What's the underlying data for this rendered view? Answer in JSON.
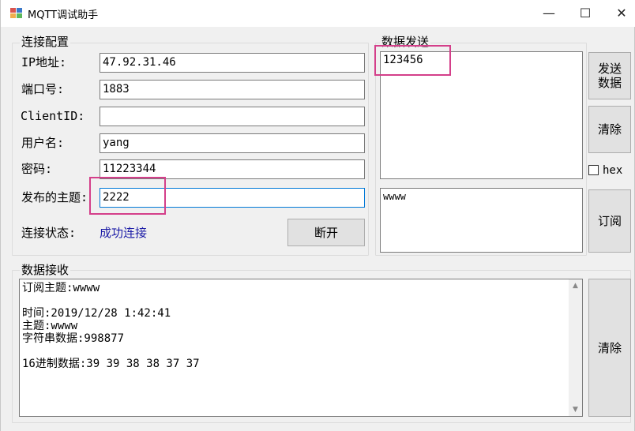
{
  "window": {
    "title": "MQTT调试助手",
    "minimize": "—",
    "maximize": "☐",
    "close": "✕"
  },
  "config": {
    "group_label": "连接配置",
    "ip_label": "IP地址:",
    "ip_value": "47.92.31.46",
    "port_label": "端口号:",
    "port_value": "1883",
    "clientid_label": "ClientID:",
    "clientid_value": "",
    "username_label": "用户名:",
    "username_value": "yang",
    "password_label": "密码:",
    "password_value": "11223344",
    "topic_label": "发布的主题:",
    "topic_value": "2222",
    "status_label": "连接状态:",
    "status_value": "成功连接",
    "disconnect_label": "断开"
  },
  "send": {
    "group_label": "数据发送",
    "send_text": "123456",
    "send_button": "发送\n数据",
    "clear_button": "清除",
    "hex_label": "hex",
    "subscribe_text": "wwww",
    "subscribe_button": "订阅"
  },
  "receive": {
    "group_label": "数据接收",
    "lines": "订阅主题:wwww\n\n时间:2019/12/28 1:42:41\n主题:wwww\n字符串数据:998877\n\n16进制数据:39 39 38 38 37 37",
    "clear_button": "清除"
  },
  "colors": {
    "highlight": "#d43f8a",
    "status": "#1a1aa6",
    "focus": "#0078d7"
  }
}
